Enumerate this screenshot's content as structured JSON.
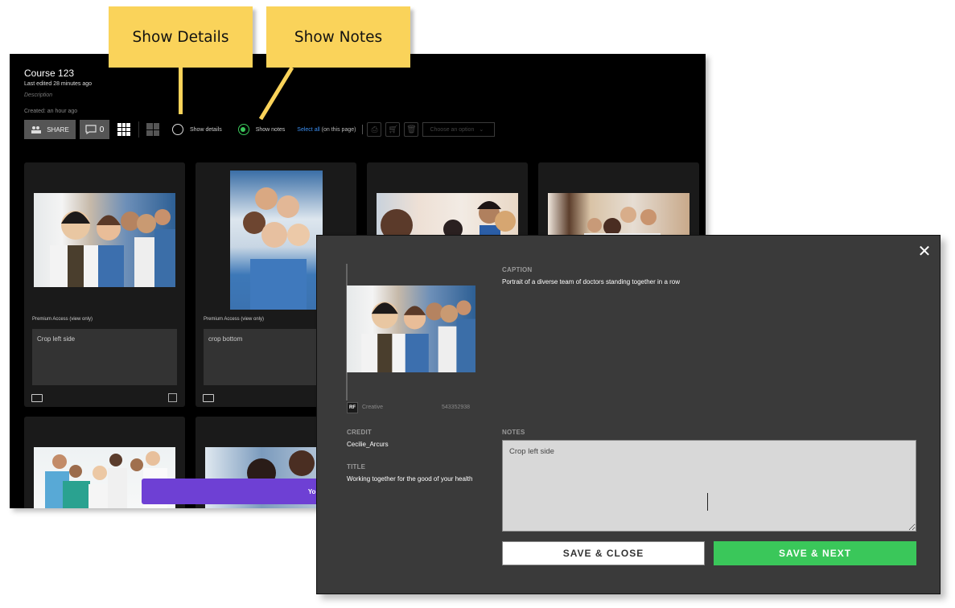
{
  "callouts": {
    "details": "Show Details",
    "notes": "Show Notes"
  },
  "app": {
    "title": "Course 123",
    "last_edited": "Last edited 28 minutes ago",
    "description_placeholder": "Description",
    "created": "Created: an hour ago"
  },
  "toolbar": {
    "share_label": "SHARE",
    "comment_count": "0",
    "show_details_label": "Show details",
    "show_details_checked": false,
    "show_notes_label": "Show notes",
    "show_notes_checked": true,
    "select_all_link": "Select all",
    "select_all_suffix": "(on this page)",
    "choose_option_placeholder": "Choose an option",
    "accent_color": "#3ac75a",
    "link_color": "#3b8ef0"
  },
  "cards": [
    {
      "access": "Premium Access (view only)",
      "note": "Crop left side",
      "image": "doctors-row-portrait"
    },
    {
      "access": "Premium Access (view only)",
      "note": "crop bottom",
      "image": "doctors-huddle-looking-down"
    },
    {
      "image": "medical-team-discussion"
    },
    {
      "image": "hospital-staff-group"
    },
    {
      "image": "doctors-nurses-hallway"
    },
    {
      "image": "doctor-with-patient"
    }
  ],
  "banner": {
    "text": "You a",
    "color": "#6e40d4"
  },
  "modal": {
    "caption_label": "CAPTION",
    "caption": "Portrait of a diverse team of doctors standing together in a row",
    "license_badge": "RF",
    "license_type": "Creative",
    "image_id": "543352938",
    "credit_label": "CREDIT",
    "credit": "Cecilie_Arcurs",
    "title_label": "TITLE",
    "title": "Working together for the good of your health",
    "notes_label": "NOTES",
    "notes_value": "Crop left side",
    "save_close_label": "SAVE & CLOSE",
    "save_next_label": "SAVE & NEXT"
  }
}
